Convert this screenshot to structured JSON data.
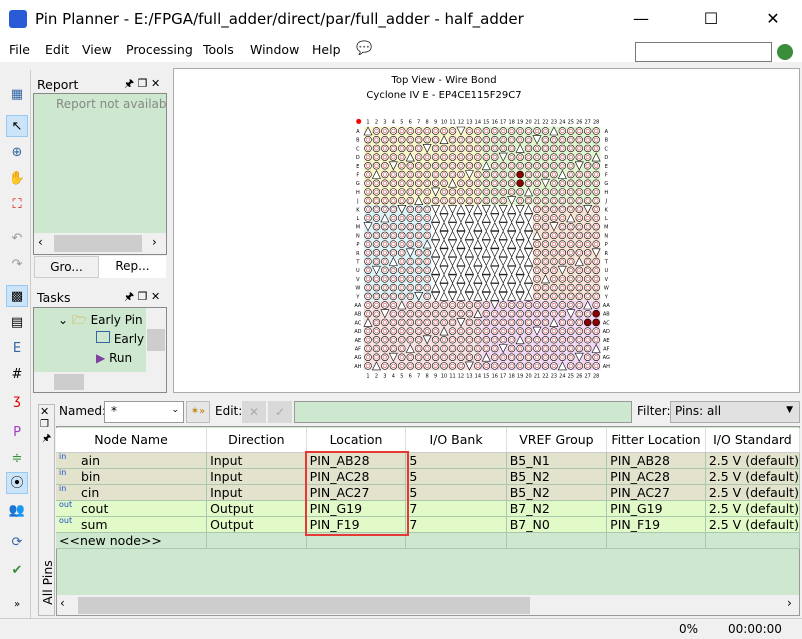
{
  "window": {
    "title": "Pin Planner - E:/FPGA/full_adder/direct/par/full_adder - half_adder",
    "minimize": "—",
    "maximize": "☐",
    "close": "✕"
  },
  "menu": [
    "File",
    "Edit",
    "View",
    "Processing",
    "Tools",
    "Window",
    "Help"
  ],
  "report": {
    "title": "Report",
    "message": "Report not available"
  },
  "left_tabs": [
    "Gro...",
    "Rep..."
  ],
  "tasks": {
    "title": "Tasks",
    "items": [
      "Early Pin",
      "Early",
      "Run"
    ]
  },
  "package": {
    "title": "Top View - Wire Bond",
    "subtitle": "Cyclone IV E - EP4CE115F29C7",
    "rows": [
      "A",
      "B",
      "C",
      "D",
      "E",
      "F",
      "G",
      "H",
      "J",
      "K",
      "L",
      "M",
      "N",
      "P",
      "R",
      "T",
      "U",
      "V",
      "W",
      "Y",
      "AA",
      "AB",
      "AC",
      "AD",
      "AE",
      "AF",
      "AG",
      "AH"
    ],
    "columns": 28,
    "assigned_pins": [
      "AB28",
      "AC28",
      "AC27",
      "G19",
      "F19"
    ],
    "assigned_color": "#8b0000"
  },
  "filter_bar": {
    "named_label": "Named:",
    "named_value": "*",
    "edit_label": "Edit:",
    "filter_label": "Filter:",
    "filter_value": "Pins: all"
  },
  "side_tab": "All Pins",
  "table": {
    "columns": [
      "Node Name",
      "Direction",
      "Location",
      "I/O Bank",
      "VREF Group",
      "Fitter Location",
      "I/O Standard"
    ],
    "rows": [
      {
        "dir_icon": "in",
        "name": "ain",
        "direction": "Input",
        "location": "PIN_AB28",
        "bank": "5",
        "vref": "B5_N1",
        "fitter": "PIN_AB28",
        "std": "2.5 V (default)"
      },
      {
        "dir_icon": "in",
        "name": "bin",
        "direction": "Input",
        "location": "PIN_AC28",
        "bank": "5",
        "vref": "B5_N2",
        "fitter": "PIN_AC28",
        "std": "2.5 V (default)"
      },
      {
        "dir_icon": "in",
        "name": "cin",
        "direction": "Input",
        "location": "PIN_AC27",
        "bank": "5",
        "vref": "B5_N2",
        "fitter": "PIN_AC27",
        "std": "2.5 V (default)"
      },
      {
        "dir_icon": "out",
        "name": "cout",
        "direction": "Output",
        "location": "PIN_G19",
        "bank": "7",
        "vref": "B7_N2",
        "fitter": "PIN_G19",
        "std": "2.5 V (default)"
      },
      {
        "dir_icon": "out",
        "name": "sum",
        "direction": "Output",
        "location": "PIN_F19",
        "bank": "7",
        "vref": "B7_N0",
        "fitter": "PIN_F19",
        "std": "2.5 V (default)"
      }
    ],
    "new_node": "<<new node>>",
    "highlight_color": "#e53935"
  },
  "status": {
    "progress": "0%",
    "time": "00:00:00"
  }
}
